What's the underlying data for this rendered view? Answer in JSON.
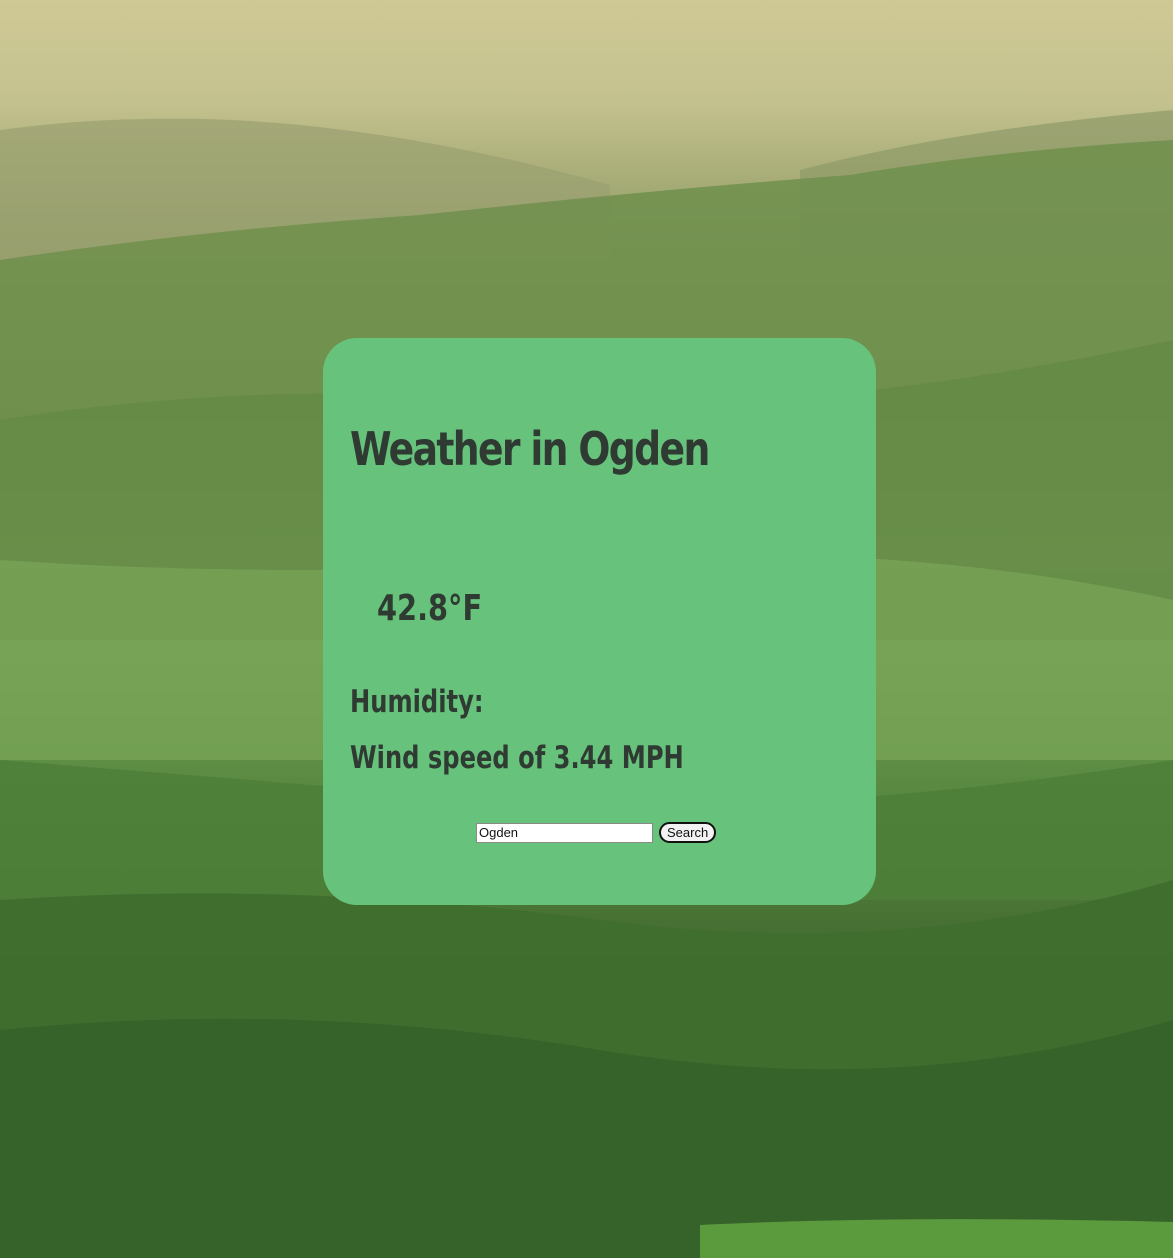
{
  "weather": {
    "title": "Weather in Ogden",
    "temperature": "42.8°F",
    "humidity": "Humidity:",
    "wind": "Wind speed of 3.44 MPH"
  },
  "search": {
    "value": "Ogden",
    "button_label": "Search"
  },
  "colors": {
    "card": "#67c27c",
    "text": "#2f3a32"
  }
}
